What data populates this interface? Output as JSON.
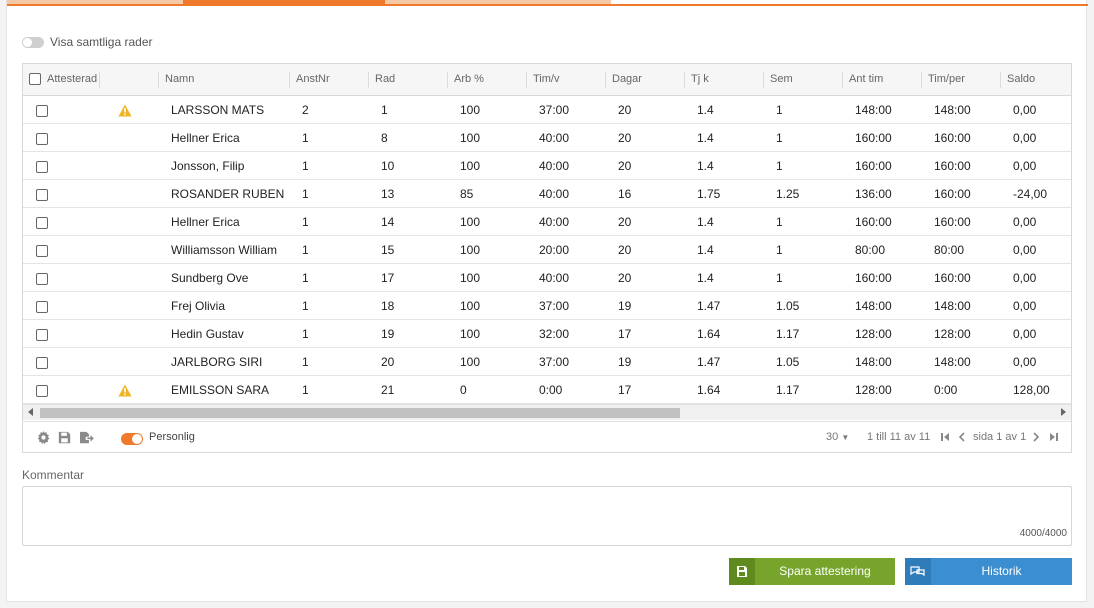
{
  "colors": {
    "accent": "#f07a2c",
    "save": "#77a52c",
    "history": "#3b8fd0",
    "warning": "#f2b321"
  },
  "show_all": {
    "label": "Visa samtliga rader"
  },
  "grid": {
    "columns": [
      "Attesterad",
      "",
      "Namn",
      "AnstNr",
      "Rad",
      "Arb %",
      "Tim/v",
      "Dagar",
      "Tj k",
      "Sem",
      "Ant tim",
      "Tim/per",
      "Saldo"
    ],
    "rows": [
      {
        "warn": true,
        "name": "LARSSON MATS",
        "anstnr": "2",
        "rad": "1",
        "arb": "100",
        "timv": "37:00",
        "dagar": "20",
        "tjk": "1.4",
        "sem": "1",
        "anttim": "148:00",
        "timper": "148:00",
        "saldo": "0,00"
      },
      {
        "warn": false,
        "name": "Hellner Erica",
        "anstnr": "1",
        "rad": "8",
        "arb": "100",
        "timv": "40:00",
        "dagar": "20",
        "tjk": "1.4",
        "sem": "1",
        "anttim": "160:00",
        "timper": "160:00",
        "saldo": "0,00"
      },
      {
        "warn": false,
        "name": "Jonsson, Filip",
        "anstnr": "1",
        "rad": "10",
        "arb": "100",
        "timv": "40:00",
        "dagar": "20",
        "tjk": "1.4",
        "sem": "1",
        "anttim": "160:00",
        "timper": "160:00",
        "saldo": "0,00"
      },
      {
        "warn": false,
        "name": "ROSANDER RUBEN",
        "anstnr": "1",
        "rad": "13",
        "arb": "85",
        "timv": "40:00",
        "dagar": "16",
        "tjk": "1.75",
        "sem": "1.25",
        "anttim": "136:00",
        "timper": "160:00",
        "saldo": "-24,00"
      },
      {
        "warn": false,
        "name": "Hellner Erica",
        "anstnr": "1",
        "rad": "14",
        "arb": "100",
        "timv": "40:00",
        "dagar": "20",
        "tjk": "1.4",
        "sem": "1",
        "anttim": "160:00",
        "timper": "160:00",
        "saldo": "0,00"
      },
      {
        "warn": false,
        "name": "Williamsson William",
        "anstnr": "1",
        "rad": "15",
        "arb": "100",
        "timv": "20:00",
        "dagar": "20",
        "tjk": "1.4",
        "sem": "1",
        "anttim": "80:00",
        "timper": "80:00",
        "saldo": "0,00"
      },
      {
        "warn": false,
        "name": "Sundberg Ove",
        "anstnr": "1",
        "rad": "17",
        "arb": "100",
        "timv": "40:00",
        "dagar": "20",
        "tjk": "1.4",
        "sem": "1",
        "anttim": "160:00",
        "timper": "160:00",
        "saldo": "0,00"
      },
      {
        "warn": false,
        "name": "Frej Olivia",
        "anstnr": "1",
        "rad": "18",
        "arb": "100",
        "timv": "37:00",
        "dagar": "19",
        "tjk": "1.47",
        "sem": "1.05",
        "anttim": "148:00",
        "timper": "148:00",
        "saldo": "0,00"
      },
      {
        "warn": false,
        "name": "Hedin Gustav",
        "anstnr": "1",
        "rad": "19",
        "arb": "100",
        "timv": "32:00",
        "dagar": "17",
        "tjk": "1.64",
        "sem": "1.17",
        "anttim": "128:00",
        "timper": "128:00",
        "saldo": "0,00"
      },
      {
        "warn": false,
        "name": "JARLBORG SIRI",
        "anstnr": "1",
        "rad": "20",
        "arb": "100",
        "timv": "37:00",
        "dagar": "19",
        "tjk": "1.47",
        "sem": "1.05",
        "anttim": "148:00",
        "timper": "148:00",
        "saldo": "0,00"
      },
      {
        "warn": true,
        "name": "EMILSSON SARA",
        "anstnr": "1",
        "rad": "21",
        "arb": "0",
        "timv": "0:00",
        "dagar": "17",
        "tjk": "1.64",
        "sem": "1.17",
        "anttim": "128:00",
        "timper": "0:00",
        "saldo": "128,00"
      }
    ]
  },
  "footer": {
    "icons": [
      "gear-icon",
      "save-icon",
      "export-icon"
    ],
    "personal_label": "Personlig",
    "page_size": "30",
    "range": "1 till 11 av 11",
    "page_text": "sida 1 av 1"
  },
  "comment": {
    "label": "Kommentar",
    "counter": "4000/4000"
  },
  "buttons": {
    "save_label": "Spara attestering",
    "history_label": "Historik"
  }
}
